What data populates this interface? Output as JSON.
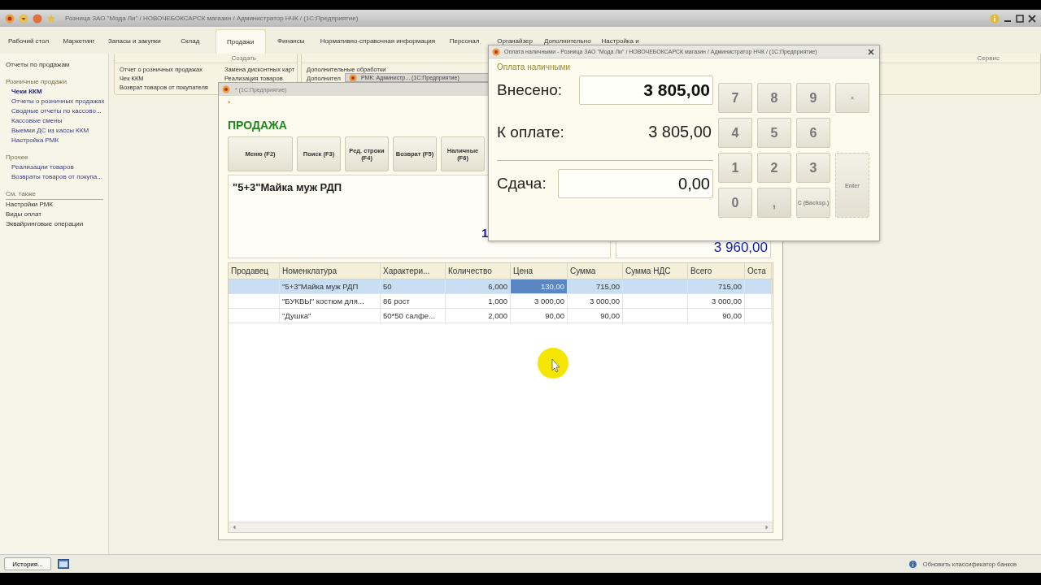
{
  "app": {
    "title": "Розница ЗАО \"Мода Ли\" / НОВОЧЕБОКСАРСК магазин / Администратор НЧК /  (1С:Предприятие)"
  },
  "sections": [
    {
      "label": "Рабочий стол",
      "selected": false
    },
    {
      "label": "Маркетинг",
      "selected": false
    },
    {
      "label": "Запасы и закупки",
      "selected": false
    },
    {
      "label": "Склад",
      "selected": false
    },
    {
      "label": "Продажи",
      "selected": true
    },
    {
      "label": "Финансы",
      "selected": false
    },
    {
      "label": "Нормативно-справочная информация",
      "selected": false
    },
    {
      "label": "Персонал",
      "selected": false
    },
    {
      "label": "Органайзер",
      "selected": false
    },
    {
      "label": "Дополнительно",
      "selected": false
    },
    {
      "label": "Настройка и",
      "selected": false
    }
  ],
  "sidebar": {
    "top_link": "Отчеты по продажам",
    "groups": [
      {
        "title": "Розничные продажи",
        "kind": "section",
        "items": [
          {
            "label": "Чеки ККМ",
            "selected": true
          },
          {
            "label": "Отчеты о розничных продажах",
            "selected": false
          },
          {
            "label": "Сводные отчеты по кассово...",
            "selected": false
          },
          {
            "label": "Кассовые смены",
            "selected": false
          },
          {
            "label": "Выемки ДС из кассы ККМ",
            "selected": false
          },
          {
            "label": "Настройка РМК",
            "selected": false
          }
        ]
      },
      {
        "title": "Прочее",
        "kind": "section",
        "items": [
          {
            "label": "Реализации товаров",
            "selected": false
          },
          {
            "label": "Возвраты товаров от покупа...",
            "selected": false
          }
        ]
      },
      {
        "title": "См. также",
        "kind": "see_also",
        "items": [
          {
            "label": "Настройки РМК",
            "selected": false
          },
          {
            "label": "Виды оплат",
            "selected": false
          },
          {
            "label": "Эквайринговые операции",
            "selected": false
          }
        ]
      }
    ]
  },
  "create_panel": {
    "title": "Создать",
    "columns": [
      [
        "Отчет о розничных продажах",
        "Чек ККМ",
        "Возврат товаров от покупателя"
      ],
      [
        "Замена дисконтных карт",
        "Реализация товаров"
      ]
    ]
  },
  "service_panel": {
    "title": "Сервис",
    "items": [
      "Дополнительные обработки",
      "Дополнител"
    ]
  },
  "background_window": {
    "title": "РМК: Администр...  (1С:Предприятие)"
  },
  "sale_window": {
    "title": "* (1С:Предприятие)",
    "marker": "*",
    "heading": "ПРОДАЖА",
    "buttons": [
      "Меню (F2)",
      "Поиск (F3)",
      "Ред. строки (F4)",
      "Возврат (F5)",
      "Наличные (F6)"
    ],
    "current_item": "\"5+3\"Майка муж РДП",
    "total_partial": "1",
    "total": "3 960,00",
    "table": {
      "columns": [
        "Продавец",
        "Номенклатура",
        "Характери...",
        "Количество",
        "Цена",
        "Сумма",
        "Сумма НДС",
        "Всего",
        "Оста"
      ],
      "rows": [
        {
          "selected": true,
          "cells": [
            "",
            "\"5+3\"Майка муж РДП",
            "50",
            "6,000",
            "130,00",
            "715,00",
            "",
            "715,00",
            ""
          ]
        },
        {
          "selected": false,
          "cells": [
            "",
            "\"БУКВЫ\" костюм для...",
            "86 рост",
            "1,000",
            "3 000,00",
            "3 000,00",
            "",
            "3 000,00",
            ""
          ]
        },
        {
          "selected": false,
          "cells": [
            "",
            "\"Душка\"",
            "50*50 салфе...",
            "2,000",
            "90,00",
            "90,00",
            "",
            "90,00",
            ""
          ]
        }
      ]
    }
  },
  "payment_dialog": {
    "title": "Оплата наличными - Розница ЗАО \"Мода Ли\" / НОВОЧЕБОКСАРСК магазин / Администратор НЧК /  (1С:Предприятие)",
    "heading": "Оплата наличными",
    "paid_label": "Внесено:",
    "paid_value": "3 805,00",
    "due_label": "К оплате:",
    "due_value": "3 805,00",
    "change_label": "Сдача:",
    "change_value": "0,00",
    "key_rows": [
      [
        {
          "label": "7",
          "kind": "digit"
        },
        {
          "label": "8",
          "kind": "digit"
        },
        {
          "label": "9",
          "kind": "digit"
        },
        {
          "label": "×",
          "kind": "clear"
        }
      ],
      [
        {
          "label": "4",
          "kind": "digit"
        },
        {
          "label": "5",
          "kind": "digit"
        },
        {
          "label": "6",
          "kind": "digit"
        }
      ],
      [
        {
          "label": "1",
          "kind": "digit"
        },
        {
          "label": "2",
          "kind": "digit"
        },
        {
          "label": "3",
          "kind": "digit"
        },
        {
          "label": "Enter",
          "kind": "enter"
        }
      ],
      [
        {
          "label": "0",
          "kind": "digit"
        },
        {
          "label": ",",
          "kind": "comma"
        },
        {
          "label": "C (Backsp.)",
          "kind": "backspace"
        }
      ]
    ]
  },
  "taskbar": {
    "history_button": "История...",
    "notice": "Обновить классификатор банков"
  }
}
